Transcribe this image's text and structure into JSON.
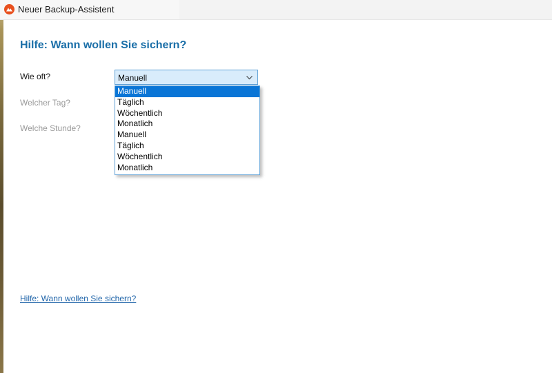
{
  "window": {
    "title": "Neuer Backup-Assistent"
  },
  "page": {
    "heading": "Hilfe: Wann wollen Sie sichern?"
  },
  "form": {
    "frequency_label": "Wie oft?",
    "day_label": "Welcher Tag?",
    "hour_label": "Welche Stunde?",
    "frequency_value": "Manuell",
    "frequency_options": [
      "Manuell",
      "Täglich",
      "Wöchentlich",
      "Monatlich",
      "Manuell",
      "Täglich",
      "Wöchentlich",
      "Monatlich"
    ],
    "selected_option_index": 0
  },
  "footer": {
    "help_link": "Hilfe: Wann wollen Sie sichern?"
  },
  "colors": {
    "heading": "#1b6fa8",
    "selection": "#0a75d6",
    "combo_border": "#5ea0d6",
    "link": "#2266aa",
    "app_icon": "#e8501e"
  },
  "icons": {
    "app": "app-logo-icon",
    "combo": "chevron-down-icon"
  }
}
